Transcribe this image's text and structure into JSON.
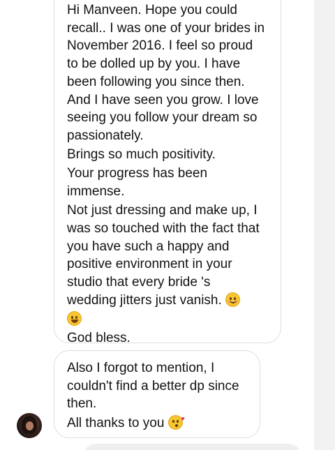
{
  "messages": [
    {
      "paragraphs": [
        "Hi Manveen. Hope you could\nrecall.. I was one of your brides in\nNovember 2016.  I feel so proud\nto be dolled up by you. I have\nbeen following you since then.\nAnd I have seen you grow. I love\nseeing you follow your dream so\npassionately.",
        "Brings so much positivity.",
        "Your progress has been\nimmense.",
        "Not just dressing and make up, I\nwas so touched with the fact that\nyou have such a happy and\npositive environment in your\nstudio that every bride 's\nwedding jitters just vanish."
      ],
      "closing": "God bless.",
      "emojis": [
        "smiling-face-with-smiling-eyes",
        "grinning-face"
      ]
    },
    {
      "paragraphs": [
        "Also I forgot to mention, I\ncouldn't find a better dp since\nthen."
      ],
      "last_line": "All thanks to you",
      "emojis": [
        "face-blowing-a-kiss"
      ]
    }
  ],
  "sender": {
    "avatar": "sender-avatar"
  }
}
